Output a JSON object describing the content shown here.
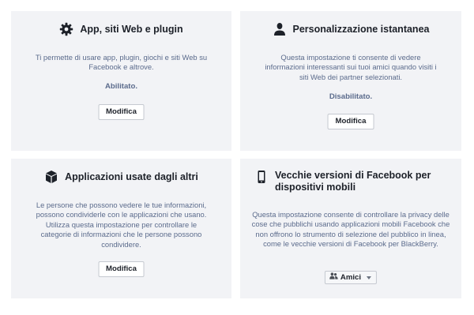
{
  "cards": [
    {
      "title": "App, siti Web e plugin",
      "icon": "gear-icon",
      "description": "Ti permette di usare app, plugin, giochi e siti Web su Facebook e altrove.",
      "status": "Abilitato.",
      "button": "Modifica"
    },
    {
      "title": "Personalizzazione istantanea",
      "icon": "person-icon",
      "description": "Questa impostazione ti consente di vedere informazioni interessanti sui tuoi amici quando visiti i siti Web dei partner selezionati.",
      "status": "Disabilitato.",
      "button": "Modifica"
    },
    {
      "title": "Applicazioni usate dagli altri",
      "icon": "cube-icon",
      "description": "Le persone che possono vedere le tue informazioni, possono condividerle con le applicazioni che usano. Utilizza questa impostazione per controllare le categorie di informazioni che le persone possono condividere.",
      "button": "Modifica"
    },
    {
      "title": "Vecchie versioni di Facebook per dispositivi mobili",
      "icon": "mobile-phone-icon",
      "description": "Questa impostazione consente di controllare la privacy delle cose che pubblichi usando applicazioni mobili Facebook che non offrono lo strumento di selezione del pubblico in linea, come le vecchie versioni di Facebook per BlackBerry.",
      "button": "Amici",
      "button_icon": "friends-icon"
    }
  ]
}
